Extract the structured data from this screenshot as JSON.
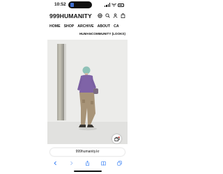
{
  "status_bar": {
    "time": "10:52"
  },
  "site": {
    "logo": "999HUMANITY",
    "header_icons": [
      "globe-icon",
      "search-icon",
      "user-icon",
      "bag-icon"
    ]
  },
  "nav": {
    "items": [
      "HOME",
      "SHOP",
      "ARCHIVE",
      "ABOUT",
      "CA"
    ],
    "sub_item": "HUMANCOMMUNITY (LOOKS)"
  },
  "browser": {
    "url": "999humanity.kr",
    "toolbar_icons": [
      "back-icon",
      "forward-icon",
      "share-icon",
      "bookmarks-icon",
      "tabs-icon"
    ]
  },
  "colors": {
    "link_blue": "#2f7bf5",
    "text": "#111111"
  }
}
